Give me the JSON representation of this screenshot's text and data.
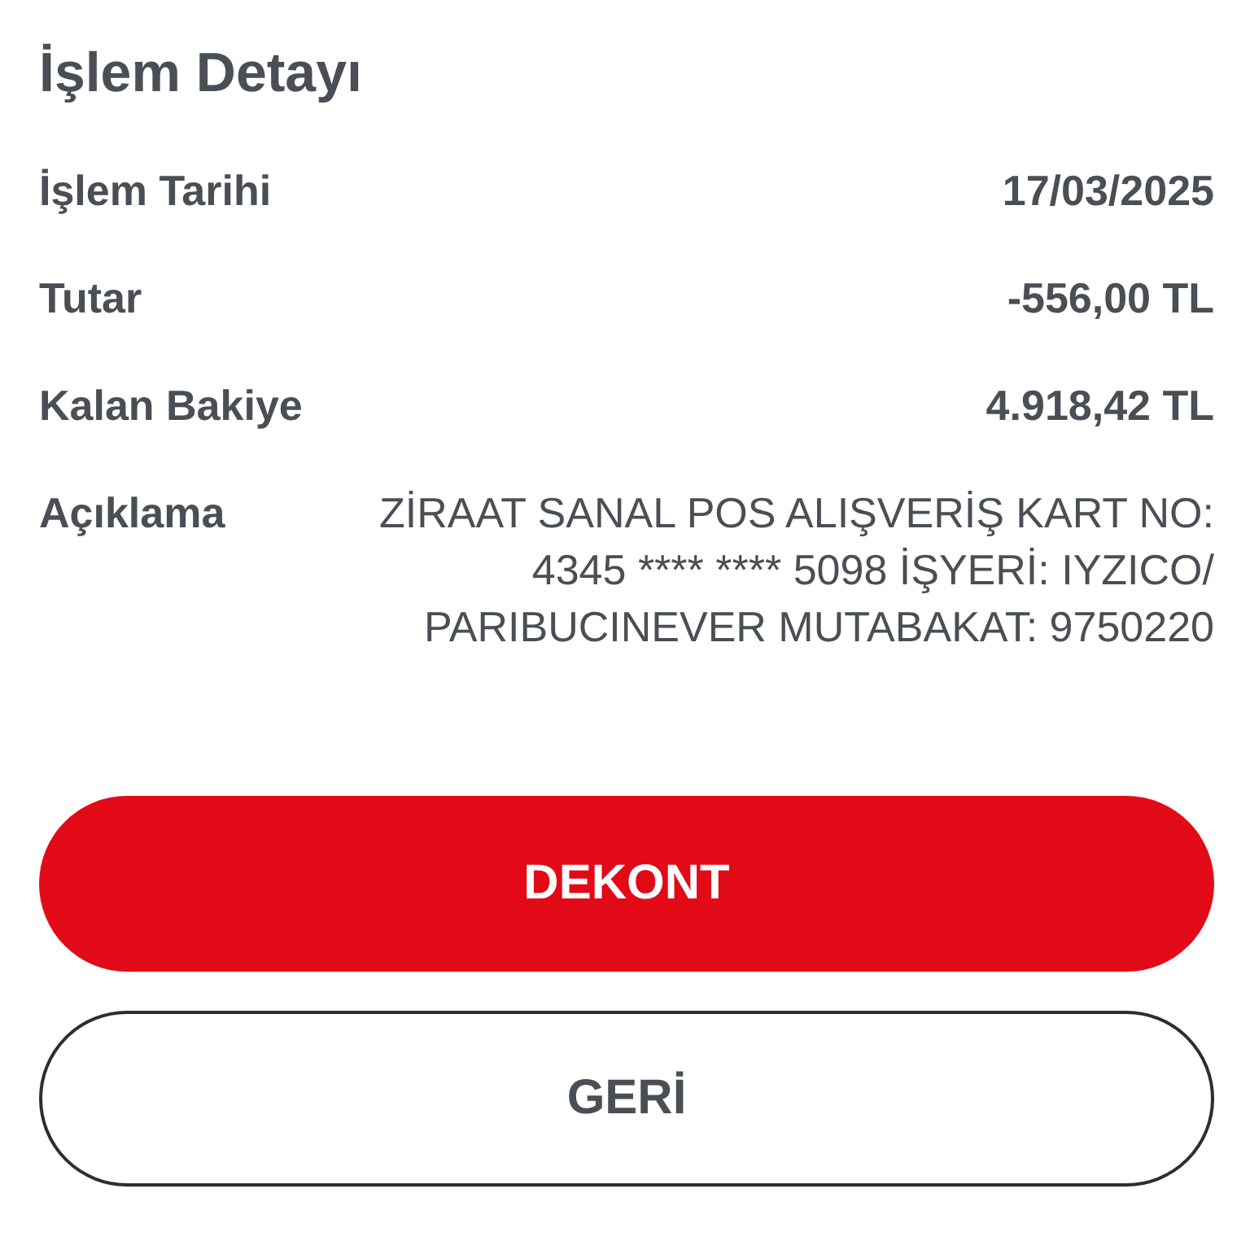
{
  "title": "İşlem Detayı",
  "details": [
    {
      "label": "İşlem Tarihi",
      "value": "17/03/2025"
    },
    {
      "label": "Tutar",
      "value": "-556,00 TL"
    },
    {
      "label": "Kalan Bakiye",
      "value": "4.918,42 TL"
    }
  ],
  "description": {
    "label": "Açıklama",
    "value": "ZİRAAT SANAL POS ALIŞVERİŞ KART NO: 4345 **** **** 5098 İŞYERİ: IYZICO/ PARIBUCINEVER MUTABAKAT: 9750220"
  },
  "buttons": [
    {
      "label": "DEKONT",
      "kind": "primary"
    },
    {
      "label": "GERİ",
      "kind": "secondary"
    }
  ]
}
